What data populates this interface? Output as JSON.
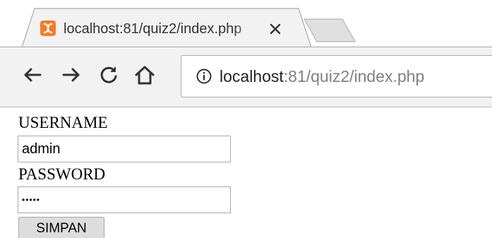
{
  "tab": {
    "title": "localhost:81/quiz2/index.php",
    "favicon_color": "#fb7a24",
    "favicon_icon": "xampp-icon",
    "close_icon": "close-icon"
  },
  "toolbar": {
    "back_icon": "back-arrow-icon",
    "forward_icon": "forward-arrow-icon",
    "reload_icon": "reload-icon",
    "home_icon": "home-icon"
  },
  "omnibox": {
    "info_icon": "info-icon",
    "url_host": "localhost",
    "url_rest": ":81/quiz2/index.php"
  },
  "form": {
    "username_label": "USERNAME",
    "username_value": "admin",
    "password_label": "PASSWORD",
    "password_masked": "•••••",
    "submit_label": "SIMPAN"
  }
}
